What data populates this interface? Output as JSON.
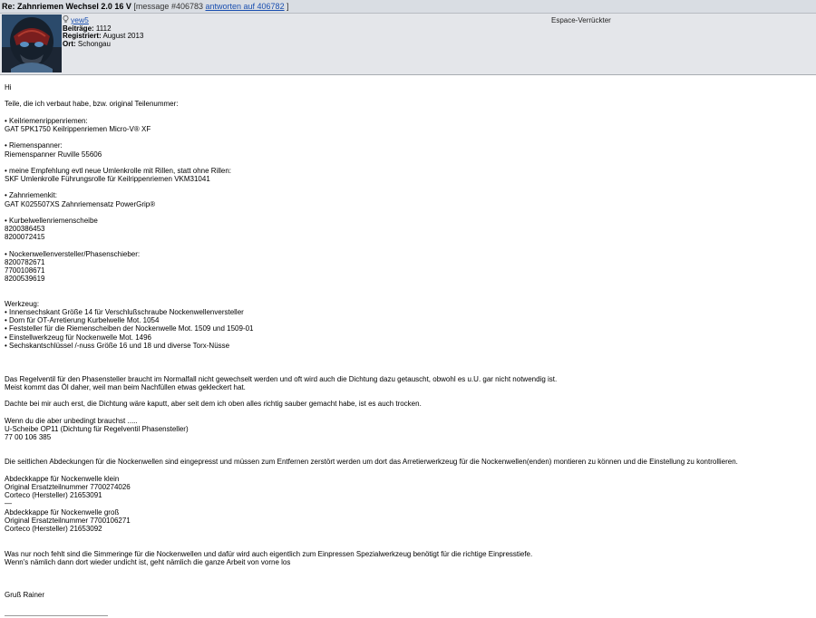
{
  "titlebar": {
    "title": "Re: Zahnriemen Wechsel 2.0 16 V",
    "message_info": "[message #406783",
    "reply_link": "antworten auf 406782",
    "bracket_close": "]"
  },
  "author": {
    "name": "yew5",
    "posts_label": "Beiträge:",
    "posts_value": "1112",
    "registered_label": "Registriert:",
    "registered_value": "August 2013",
    "location_label": "Ort:",
    "location_value": "Schongau",
    "rank": "Espace-Verrückter"
  },
  "post_lines": [
    "Hi",
    "",
    "Teile, die ich verbaut habe, bzw. original Teilenummer:",
    "",
    "• Keilriemenrippenriemen:",
    "GAT 5PK1750 Keilrippenriemen Micro-V® XF",
    "",
    "• Riemenspanner:",
    "Riemenspanner Ruville 55606",
    "",
    "• meine Empfehlung evtl neue Umlenkrolle mit Rillen, statt ohne Rillen:",
    "SKF Umlenkrolle Führungsrolle für Keilrippenriemen VKM31041",
    "",
    "• Zahnriemenkit:",
    "GAT K025507XS Zahnriemensatz PowerGrip®",
    "",
    "• Kurbelwellenriemenscheibe",
    "8200386453",
    "8200072415",
    "",
    "• Nockenwellenversteller/Phasenschieber:",
    "8200782671",
    "7700108671",
    "8200539619",
    "",
    "",
    "Werkzeug:",
    "• Innensechskant Größe 14 für Verschlußschraube Nockenwellenversteller",
    "• Dorn für OT-Arretierung Kurbelwelle Mot. 1054",
    "• Feststeller für die Riemenscheiben der Nockenwelle Mot. 1509 und 1509-01",
    "• Einstellwerkzeug für Nockenwelle Mot. 1496",
    "• Sechskantschlüssel /-nuss Größe 16 und 18 und diverse Torx-Nüsse",
    "",
    "",
    "",
    "Das Regelventil für den Phasensteller braucht im Normalfall nicht gewechselt werden und oft wird auch die Dichtung dazu getauscht, obwohl es u.U. gar nicht notwendig ist.",
    "Meist kommt das Öl daher, weil man beim Nachfüllen etwas gekleckert hat.",
    "",
    "Dachte bei mir auch erst, die Dichtung wäre kaputt, aber seit dem ich oben alles richtig sauber gemacht habe, ist es auch trocken.",
    "",
    "Wenn du die aber unbedingt brauchst .....",
    "U-Scheibe OP11 (Dichtung für Regelventil Phasensteller)",
    "77 00 106 385",
    "",
    "",
    "Die seitlichen Abdeckungen für die Nockenwellen sind eingepresst und müssen zum Entfernen zerstört werden um dort das Arretierwerkzeug für die Nockenwellen(enden) montieren zu können und die Einstellung zu kontrollieren.",
    "",
    "Abdeckkappe für Nockenwelle klein",
    "Original Ersatzteilnummer 7700274026",
    "Corteco (Hersteller) 21653091",
    "—",
    "Abdeckkappe für Nockenwelle groß",
    "Original Ersatzteilnummer 7700106271",
    "Corteco (Hersteller) 21653092",
    "",
    "",
    "Was nur noch fehlt sind die Simmeringe für die Nockenwellen und dafür wird auch eigentlich zum Einpressen Spezialwerkzeug benötigt für die richtige Einpresstiefe.",
    "Wenn's nämlich dann dort wieder undicht ist, geht nämlich die ganze Arbeit von vorne los",
    "",
    "",
    "",
    "Gruß Rainer"
  ]
}
